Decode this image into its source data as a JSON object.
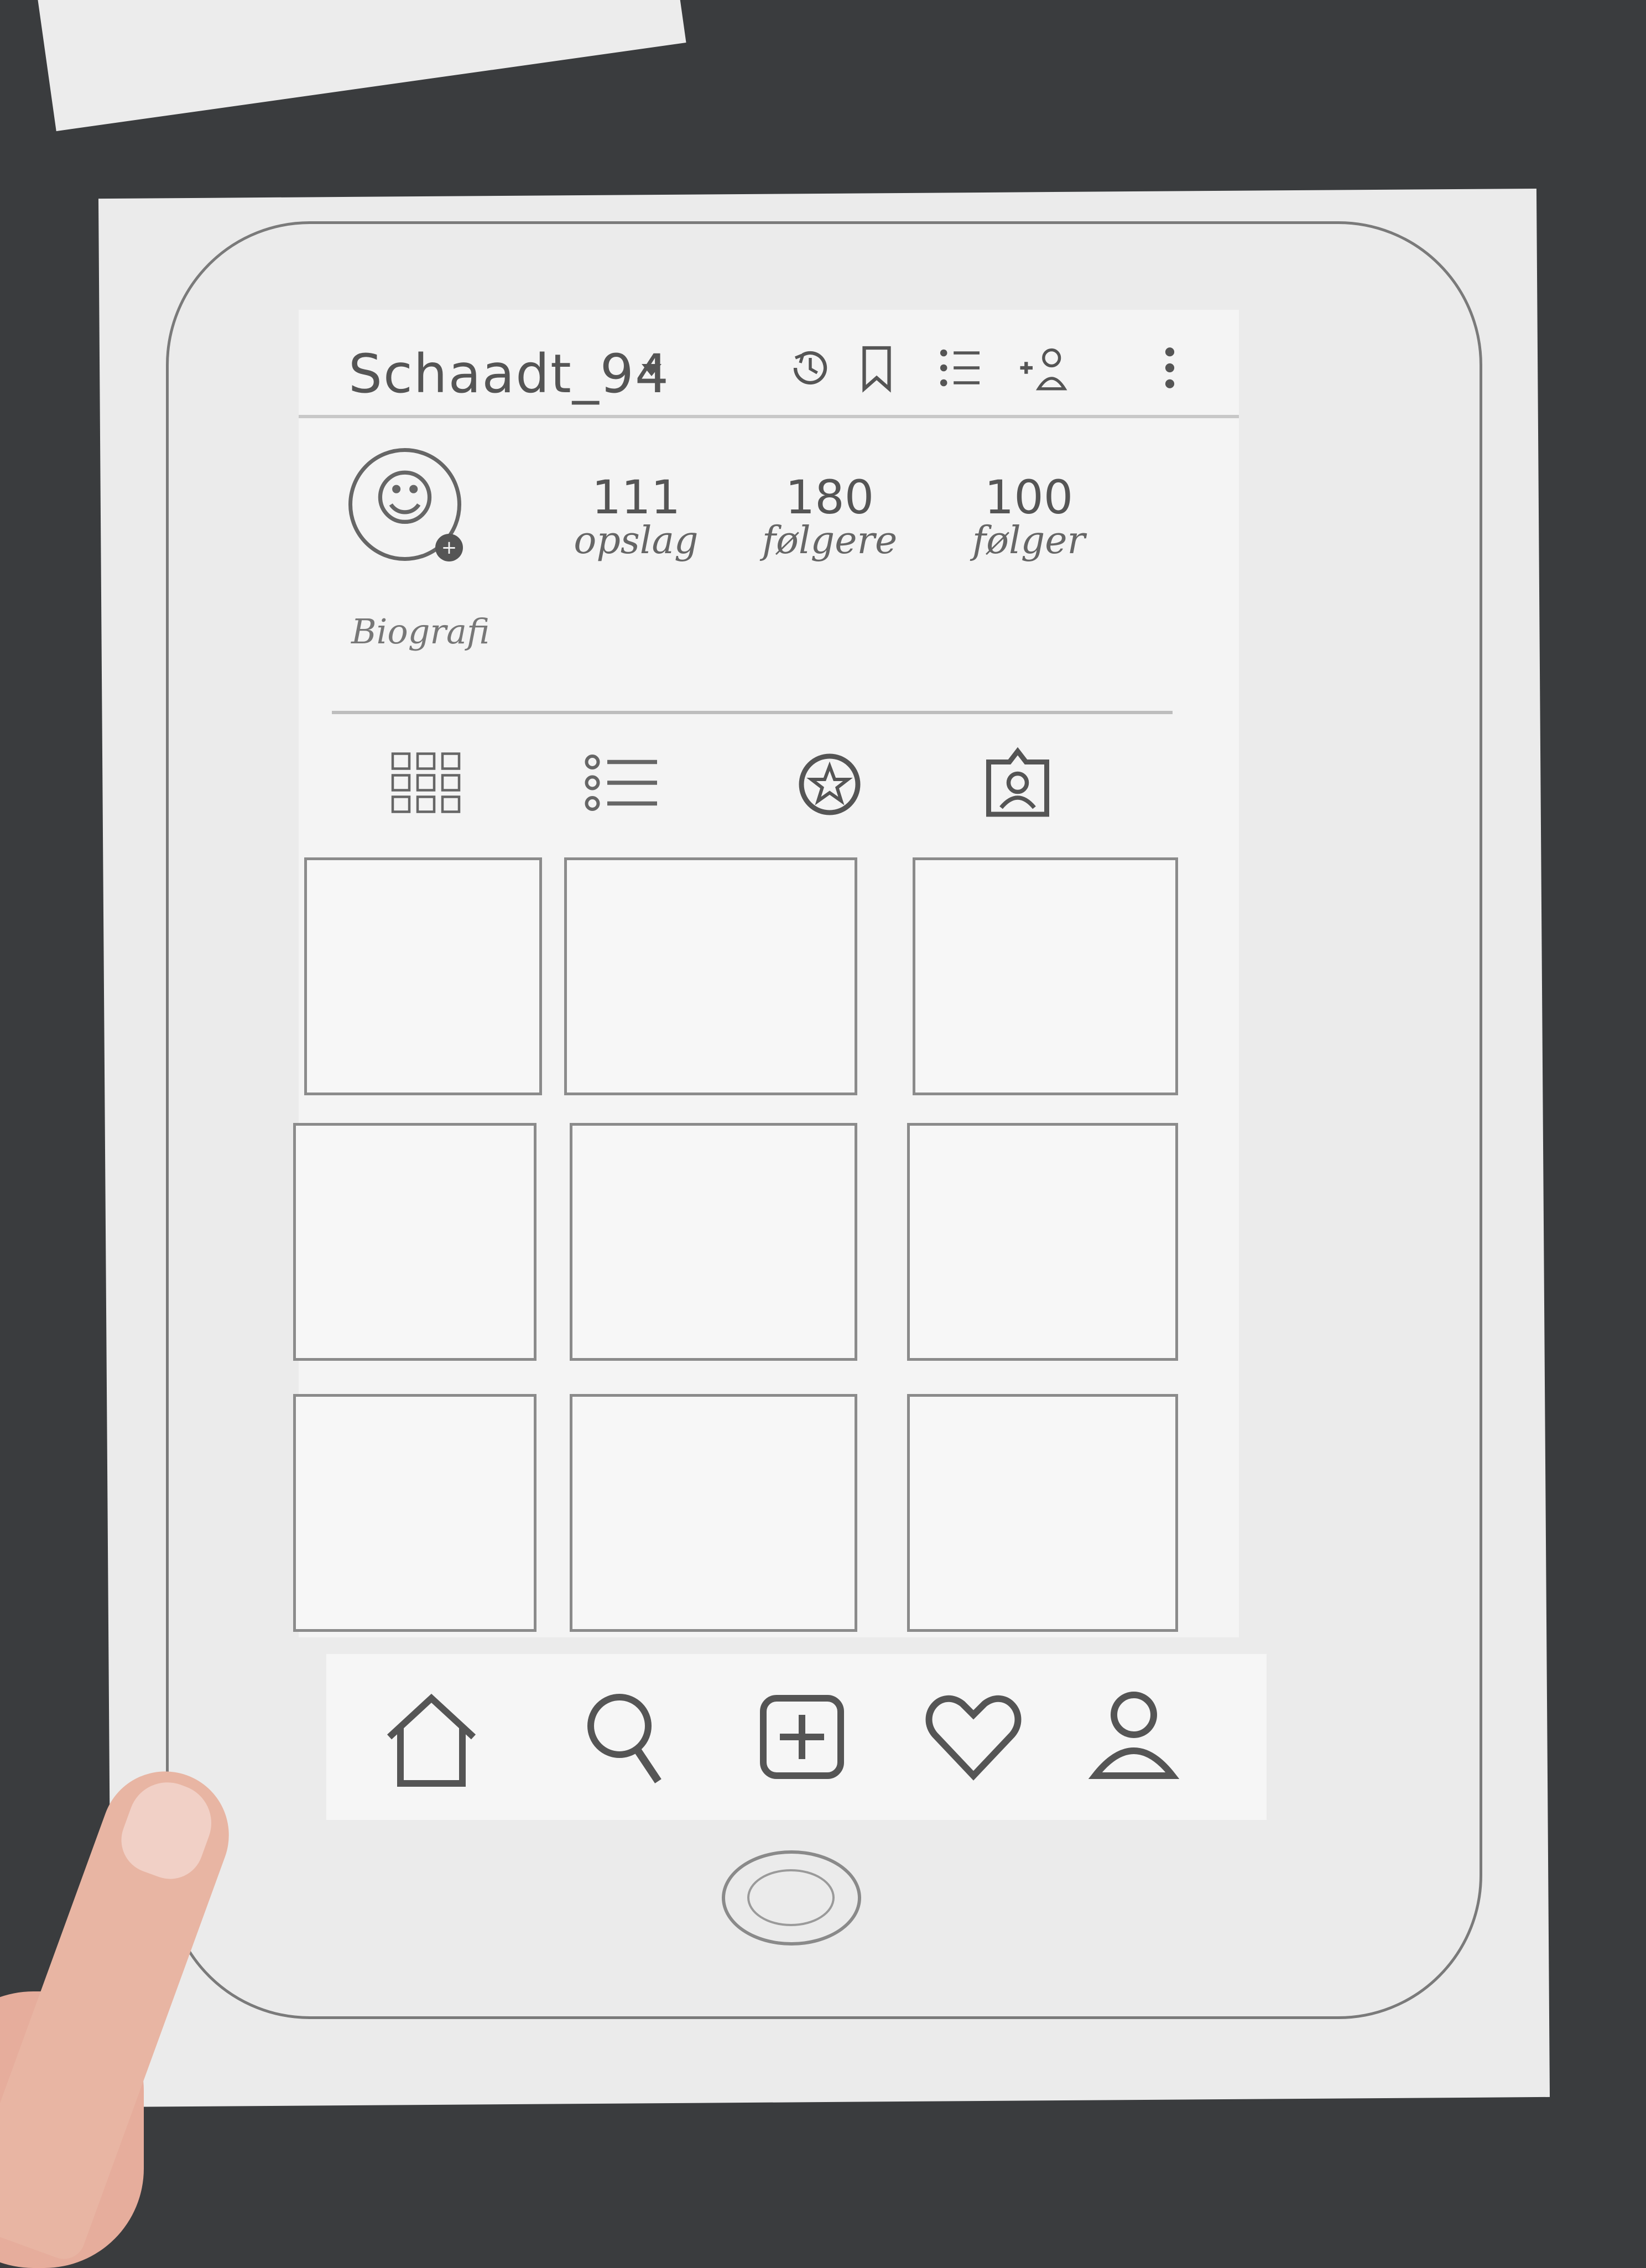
{
  "header": {
    "username": "Schaadt_94",
    "icons": [
      "history-icon",
      "bookmark-icon",
      "list-icon",
      "add-person-icon",
      "more-icon"
    ]
  },
  "profile": {
    "avatar_face": "☺",
    "avatar_badge": "+",
    "stats": [
      {
        "value": "111",
        "label": "opslag"
      },
      {
        "value": "180",
        "label": "følgere"
      },
      {
        "value": "100",
        "label": "følger"
      }
    ],
    "bio": "Biografi"
  },
  "tabs": [
    "grid-icon",
    "list-icon",
    "star-icon",
    "tagged-person-icon"
  ],
  "bottom_nav": [
    "home-icon",
    "search-icon",
    "add-post-icon",
    "heart-icon",
    "profile-icon"
  ]
}
